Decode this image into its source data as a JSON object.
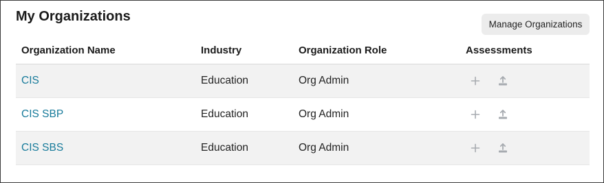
{
  "title": "My Organizations",
  "manage_button": "Manage Organizations",
  "columns": [
    "Organization Name",
    "Industry",
    "Organization Role",
    "Assessments"
  ],
  "rows": [
    {
      "name": "CIS",
      "industry": "Education",
      "role": "Org Admin",
      "shaded": true
    },
    {
      "name": "CIS SBP",
      "industry": "Education",
      "role": "Org Admin",
      "shaded": false
    },
    {
      "name": "CIS SBS",
      "industry": "Education",
      "role": "Org Admin",
      "shaded": true
    }
  ],
  "icons": {
    "add": "plus-icon",
    "upload": "upload-icon"
  },
  "colors": {
    "link": "#167a9a",
    "row_shade": "#f2f2f2",
    "button_bg": "#ececec",
    "icon": "#a7abb0"
  }
}
